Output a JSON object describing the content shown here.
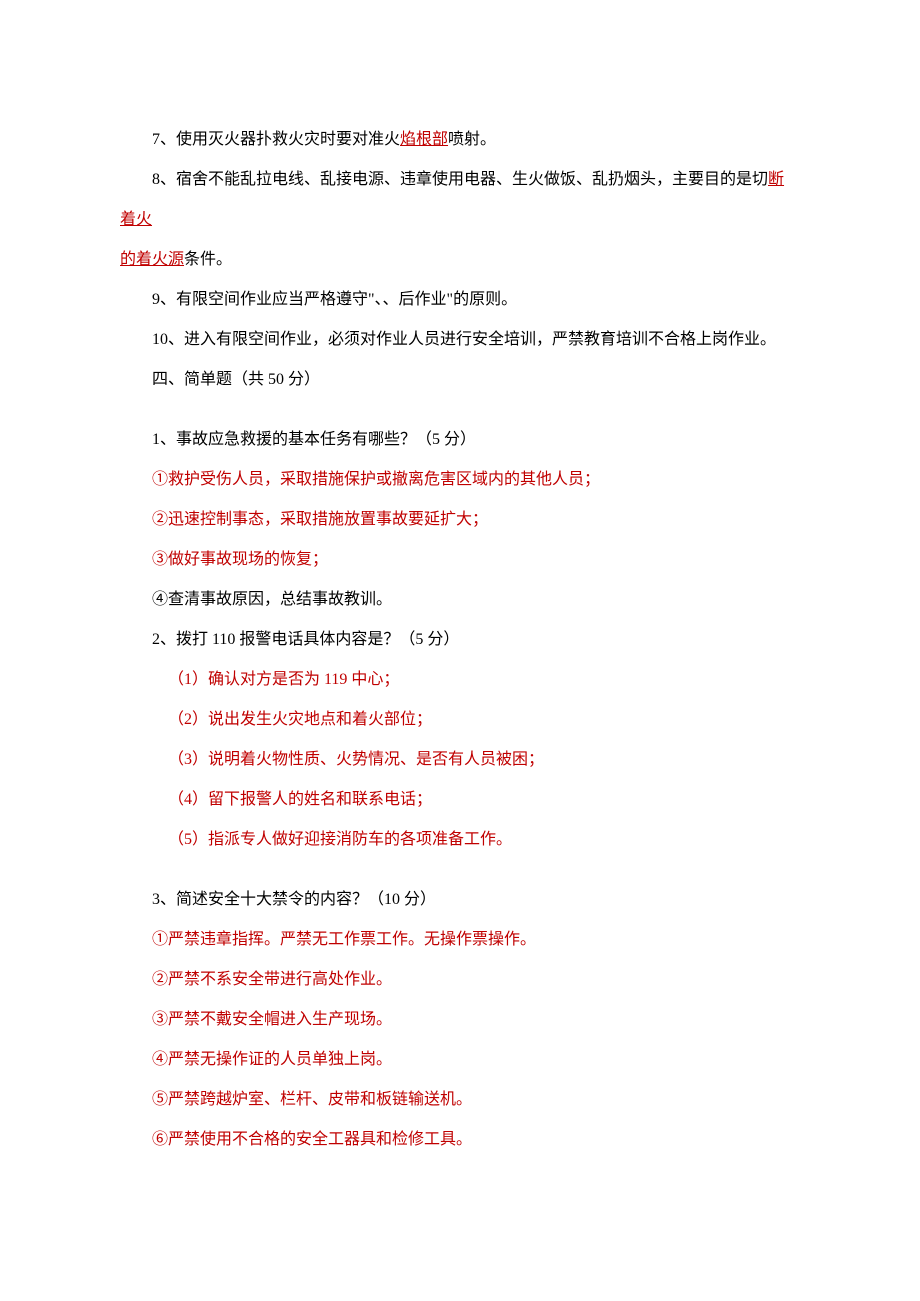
{
  "q7": {
    "pre": "7、使用灭火器扑救火灾时要对准火",
    "ans": "焰根部",
    "post": "喷射。"
  },
  "q8": {
    "pre": "8、宿舍不能乱拉电线、乱接电源、违章使用电器、生火做饭、乱扔烟头，主要目的是切",
    "ans1": "断着火",
    "ans2": "的着火源",
    "post": "条件。"
  },
  "q9": "9、有限空间作业应当严格遵守\"、、后作业\"的原则。",
  "q10": "10、进入有限空间作业，必须对作业人员进行安全培训，严禁教育培训不合格上岗作业。",
  "section4": "四、简单题（共 50 分）",
  "sq1": {
    "q": "1、事故应急救援的基本任务有哪些？（5 分）",
    "a1": "①救护受伤人员，采取措施保护或撤离危害区域内的其他人员；",
    "a2": "②迅速控制事态，采取措施放置事故要延扩大；",
    "a3": "③做好事故现场的恢复；",
    "a4": "④查清事故原因，总结事故教训。"
  },
  "sq2": {
    "q": "2、拨打 110 报警电话具体内容是？（5 分）",
    "a1": "（1）确认对方是否为 119 中心；",
    "a2": "（2）说出发生火灾地点和着火部位；",
    "a3": "（3）说明着火物性质、火势情况、是否有人员被困；",
    "a4": "（4）留下报警人的姓名和联系电话；",
    "a5": "（5）指派专人做好迎接消防车的各项准备工作。"
  },
  "sq3": {
    "q": "3、简述安全十大禁令的内容？（10 分）",
    "a1": "①严禁违章指挥。严禁无工作票工作。无操作票操作。",
    "a2": "②严禁不系安全带进行高处作业。",
    "a3": "③严禁不戴安全帽进入生产现场。",
    "a4": "④严禁无操作证的人员单独上岗。",
    "a5": "⑤严禁跨越炉室、栏杆、皮带和板链输送机。",
    "a6": "⑥严禁使用不合格的安全工器具和检修工具。"
  }
}
